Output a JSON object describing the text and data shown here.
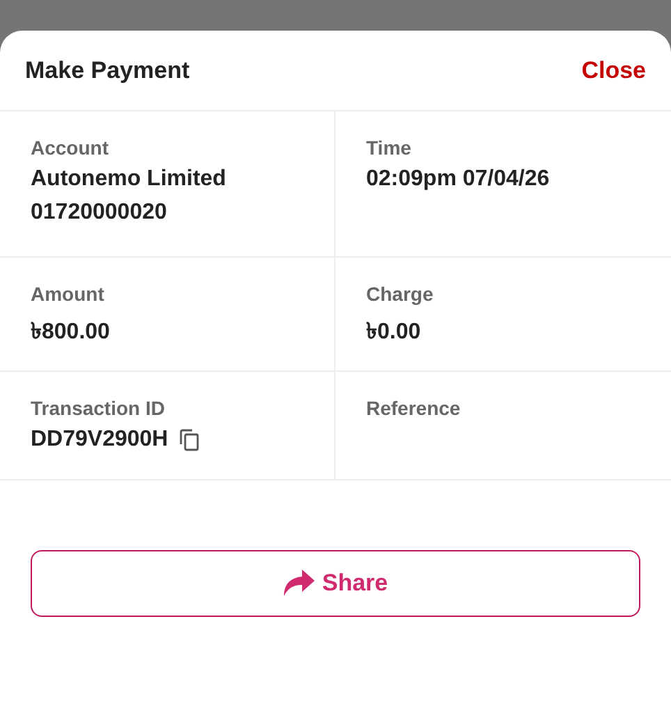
{
  "sheet": {
    "title": "Make Payment",
    "close": "Close"
  },
  "details": [
    {
      "label": "Account",
      "values": [
        "Autonemo Limited",
        "01720000020"
      ],
      "copyable": false
    },
    {
      "label": "Time",
      "values": [
        "02:09pm 07/04/26"
      ],
      "copyable": false
    },
    {
      "label": "Amount",
      "values": [
        "৳800.00"
      ],
      "copyable": false
    },
    {
      "label": "Charge",
      "values": [
        "৳0.00"
      ],
      "copyable": false
    },
    {
      "label": "Transaction ID",
      "values": [
        "DD79V2900H"
      ],
      "copyable": true
    },
    {
      "label": "Reference",
      "copyable": false
    }
  ],
  "share_button": {
    "label": "Share"
  }
}
